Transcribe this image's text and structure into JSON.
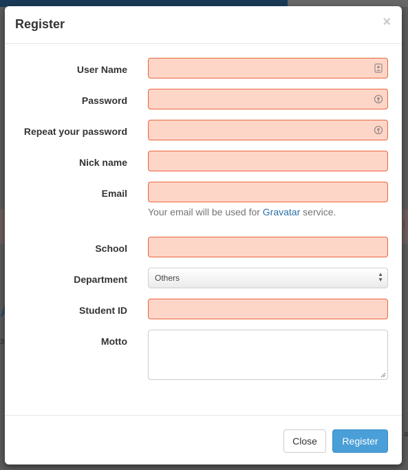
{
  "background": {
    "side_text_right": "[",
    "side_text_left": "3",
    "side_text_right_low": "a",
    "side_letter": "A"
  },
  "modal": {
    "title": "Register",
    "close_glyph": "×"
  },
  "form": {
    "fields": [
      {
        "label": "User Name",
        "value": "",
        "icon": "contact-card-icon"
      },
      {
        "label": "Password",
        "value": "",
        "icon": "key-icon"
      },
      {
        "label": "Repeat your password",
        "value": "",
        "icon": "key-icon"
      },
      {
        "label": "Nick name",
        "value": ""
      },
      {
        "label": "Email",
        "value": ""
      },
      {
        "label": "School",
        "value": ""
      },
      {
        "label": "Department",
        "selected": "Others"
      },
      {
        "label": "Student ID",
        "value": ""
      },
      {
        "label": "Motto",
        "value": ""
      }
    ],
    "email_help": {
      "prefix": "Your email will be used for ",
      "link": "Gravatar",
      "suffix": " service."
    }
  },
  "footer": {
    "close_label": "Close",
    "register_label": "Register"
  },
  "colors": {
    "invalid_border": "#e9643b",
    "invalid_fill": "#fdd6c8",
    "primary": "#4a9fd8",
    "link": "#2a6fa8"
  }
}
